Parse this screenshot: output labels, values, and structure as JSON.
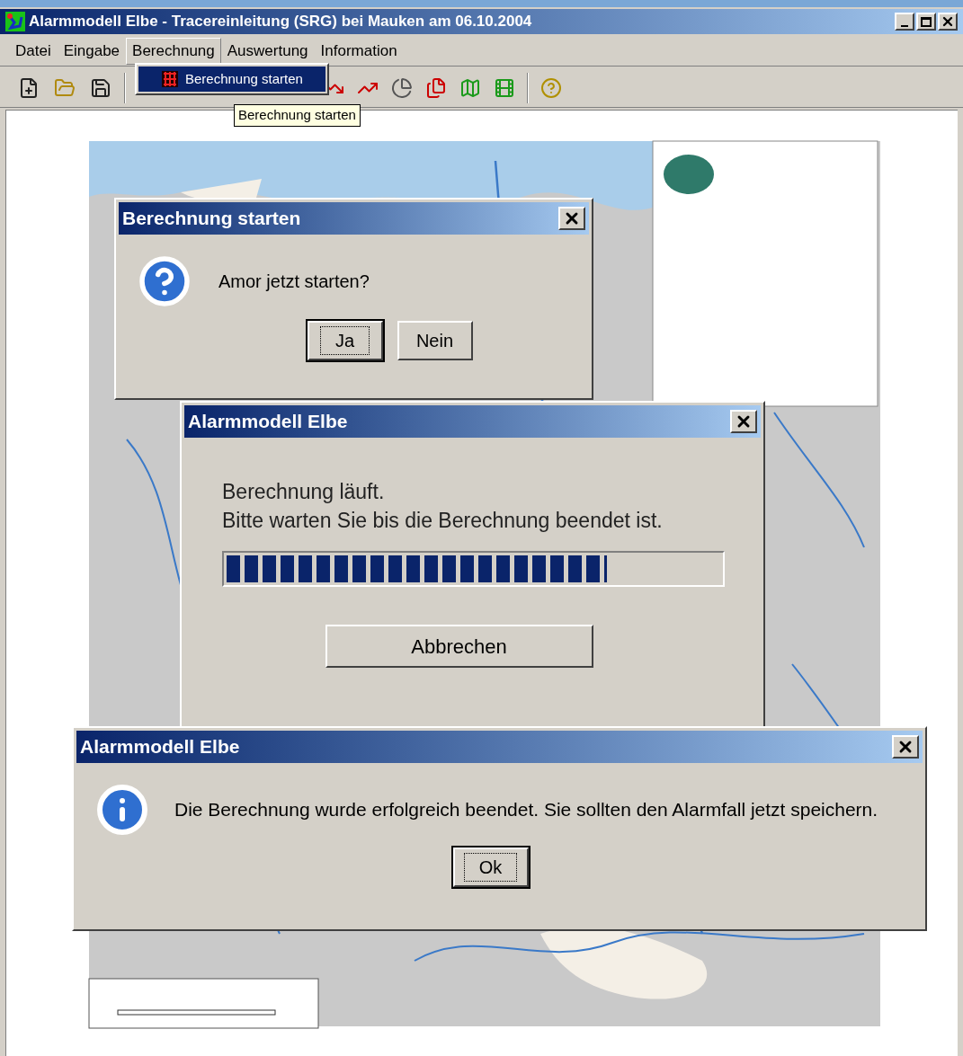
{
  "window": {
    "title": "Alarmmodell Elbe - Tracereinleitung (SRG) bei Mauken am 06.10.2004"
  },
  "menu": [
    {
      "label": "Datei",
      "selected": false
    },
    {
      "label": "Eingabe",
      "selected": false
    },
    {
      "label": "Berechnung",
      "selected": true
    },
    {
      "label": "Auswertung",
      "selected": false
    },
    {
      "label": "Information",
      "selected": false
    }
  ],
  "dropdown": {
    "items": [
      {
        "label": "Berechnung starten",
        "selected": true
      }
    ]
  },
  "tooltip": "Berechnung starten",
  "dialogs": [
    {
      "kind": "question",
      "title": "Berechnung starten",
      "message": "Amor jetzt starten?",
      "buttons": [
        {
          "label": "Ja",
          "focused": true
        },
        {
          "label": "Nein",
          "focused": false
        }
      ]
    },
    {
      "kind": "progress",
      "title": "Alarmmodell Elbe",
      "message_lines": [
        "Berechnung läuft.",
        "Bitte warten Sie bis die Berechnung beendet ist."
      ],
      "level": 0.77,
      "buttons": [
        {
          "label": "Abbrechen",
          "focused": false
        }
      ]
    },
    {
      "kind": "info",
      "title": "Alarmmodell Elbe",
      "message": "Die Berechnung wurde erfolgreich beendet. Sie sollten den Alarmfall jetzt speichern.",
      "buttons": [
        {
          "label": "Ok",
          "focused": true
        }
      ]
    }
  ]
}
